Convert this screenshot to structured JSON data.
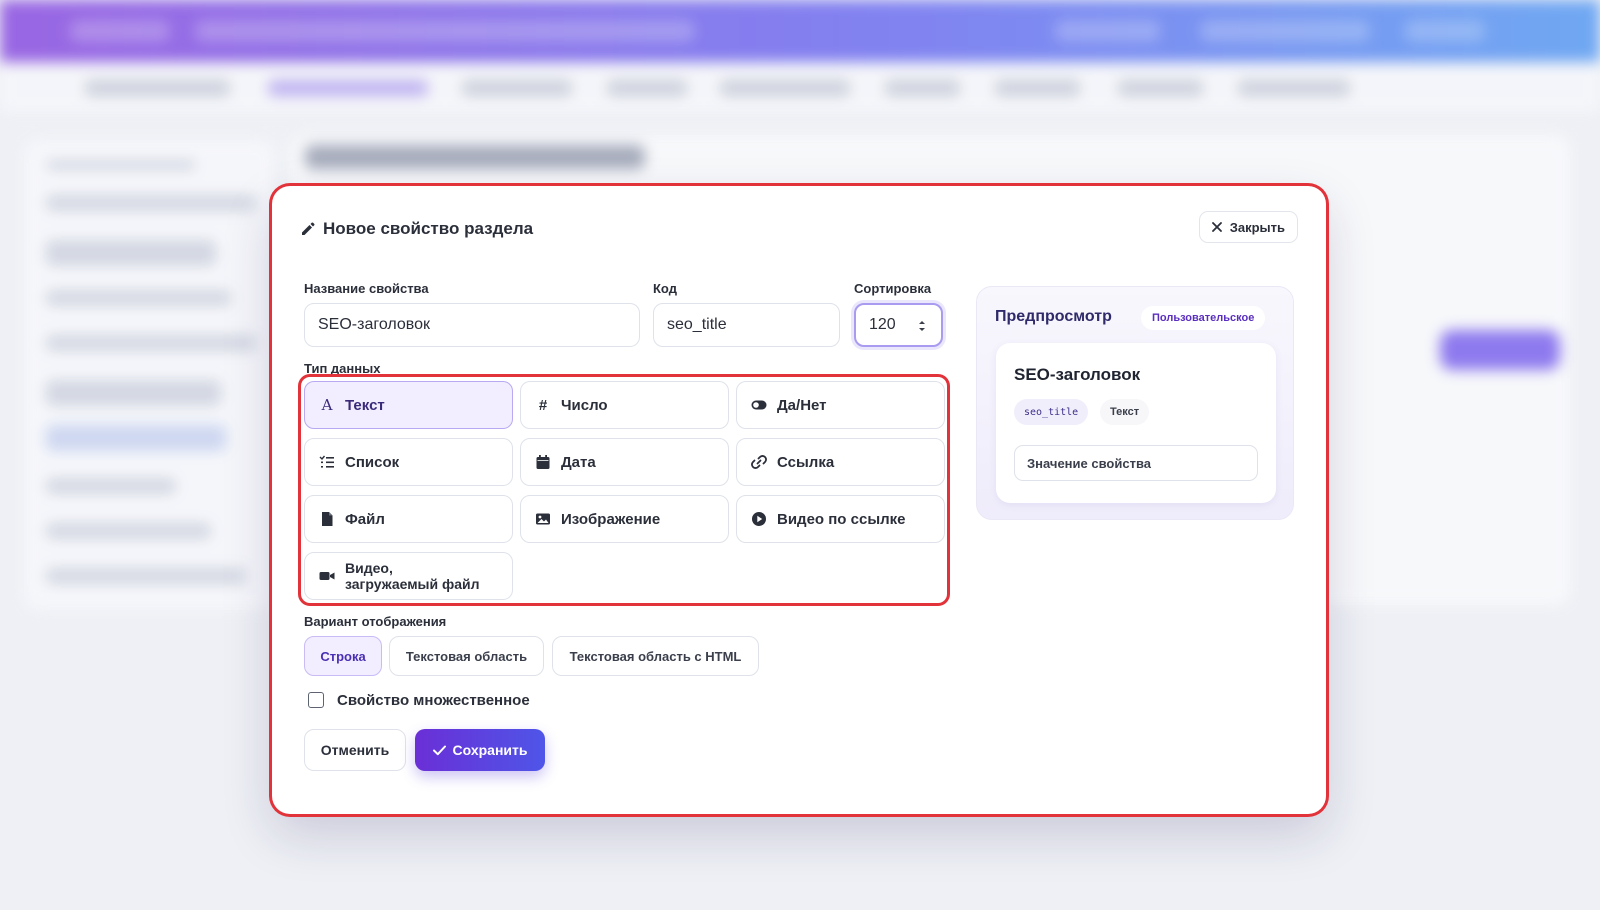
{
  "modal": {
    "title": "Новое свойство раздела",
    "close_label": "Закрыть"
  },
  "form": {
    "name_label": "Название свойства",
    "name_value": "SEO-заголовок",
    "code_label": "Код",
    "code_value": "seo_title",
    "sort_label": "Сортировка",
    "sort_value": "120",
    "data_type_label": "Тип данных",
    "data_types": [
      {
        "label": "Текст",
        "icon": "text-icon",
        "selected": true
      },
      {
        "label": "Число",
        "icon": "hash-icon",
        "selected": false
      },
      {
        "label": "Да/Нет",
        "icon": "toggle-icon",
        "selected": false
      },
      {
        "label": "Список",
        "icon": "list-icon",
        "selected": false
      },
      {
        "label": "Дата",
        "icon": "calendar-icon",
        "selected": false
      },
      {
        "label": "Ссылка",
        "icon": "link-icon",
        "selected": false
      },
      {
        "label": "Файл",
        "icon": "file-icon",
        "selected": false
      },
      {
        "label": "Изображение",
        "icon": "image-icon",
        "selected": false
      },
      {
        "label": "Видео по ссылке",
        "icon": "play-icon",
        "selected": false
      },
      {
        "label_line1": "Видео,",
        "label_line2": "загружаемый файл",
        "icon": "video-camera-icon",
        "selected": false
      }
    ],
    "display_label": "Вариант отображения",
    "display_options": [
      {
        "label": "Строка",
        "selected": true
      },
      {
        "label": "Текстовая область",
        "selected": false
      },
      {
        "label": "Текстовая область с HTML",
        "selected": false
      }
    ],
    "multiple_label": "Свойство множественное",
    "multiple_checked": false,
    "cancel_label": "Отменить",
    "save_label": "Сохранить"
  },
  "preview": {
    "title": "Предпросмотр",
    "badge": "Пользовательское",
    "card_title": "SEO-заголовок",
    "card_code": "seo_title",
    "card_type": "Текст",
    "card_input_placeholder": "Значение свойства"
  },
  "colors": {
    "accent": "#6a2fd6",
    "highlight_frame": "#e2333a",
    "selected_bg": "#f2edff"
  }
}
